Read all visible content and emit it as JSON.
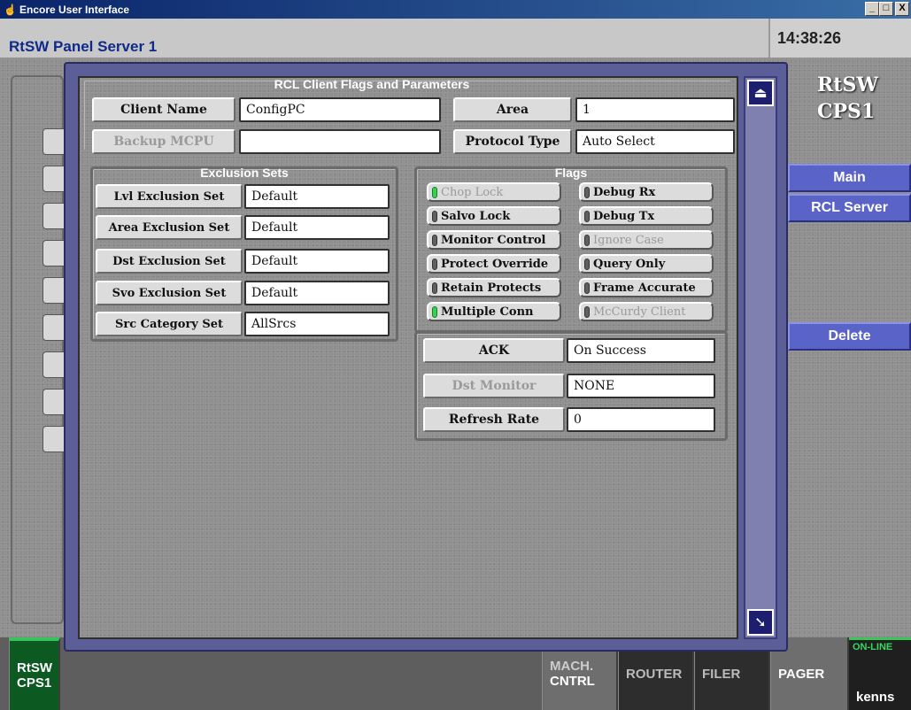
{
  "window": {
    "title": "Encore User Interface",
    "min": "_",
    "max": "□",
    "close": "X"
  },
  "header": {
    "title": "RtSW Panel Server 1",
    "time": "14:38:26"
  },
  "right_panel": {
    "logo_line1": "RtSW",
    "logo_line2": "CPS1",
    "main_button": "Main",
    "rcl_server_button": "RCL Server",
    "delete_button": "Delete"
  },
  "dialog": {
    "title": "RCL Client Flags and Parameters",
    "client_name_label": "Client Name",
    "client_name_value": "ConfigPC",
    "area_label": "Area",
    "area_value": "1",
    "backup_mcpu_label": "Backup MCPU",
    "backup_mcpu_value": "",
    "protocol_type_label": "Protocol Type",
    "protocol_type_value": "Auto Select",
    "exclusion": {
      "title": "Exclusion Sets",
      "rows": [
        {
          "label": "Lvl Exclusion Set",
          "value": "Default"
        },
        {
          "label": "Area Exclusion Set",
          "value": "Default"
        },
        {
          "label": "Dst Exclusion Set",
          "value": "Default"
        },
        {
          "label": "Svo Exclusion Set",
          "value": "Default"
        },
        {
          "label": "Src Category Set",
          "value": "AllSrcs"
        }
      ]
    },
    "flags": {
      "title": "Flags",
      "items": [
        {
          "label": "Chop Lock",
          "on": true,
          "enabled": false
        },
        {
          "label": "Debug Rx",
          "on": false,
          "enabled": true
        },
        {
          "label": "Salvo Lock",
          "on": false,
          "enabled": true
        },
        {
          "label": "Debug Tx",
          "on": false,
          "enabled": true
        },
        {
          "label": "Monitor Control",
          "on": false,
          "enabled": true
        },
        {
          "label": "Ignore Case",
          "on": false,
          "enabled": false
        },
        {
          "label": "Protect Override",
          "on": false,
          "enabled": true
        },
        {
          "label": "Query Only",
          "on": false,
          "enabled": true
        },
        {
          "label": "Retain Protects",
          "on": false,
          "enabled": true
        },
        {
          "label": "Frame Accurate",
          "on": false,
          "enabled": true
        },
        {
          "label": "Multiple Conn",
          "on": true,
          "enabled": true
        },
        {
          "label": "McCurdy Client",
          "on": false,
          "enabled": false
        }
      ]
    },
    "ack_label": "ACK",
    "ack_value": "On Success",
    "dst_monitor_label": "Dst Monitor",
    "dst_monitor_value": "NONE",
    "refresh_rate_label": "Refresh Rate",
    "refresh_rate_value": "0",
    "scroll_up": "⏏",
    "scroll_down": "➘"
  },
  "bottom_bar": {
    "rtsw_line1": "RtSW",
    "rtsw_line2": "CPS1",
    "mach_line1": "MACH.",
    "mach_line2": "CNTRL",
    "router": "ROUTER",
    "filer": "FILER",
    "pager": "PAGER",
    "online_tag": "ON-LINE",
    "user": "kenns"
  }
}
